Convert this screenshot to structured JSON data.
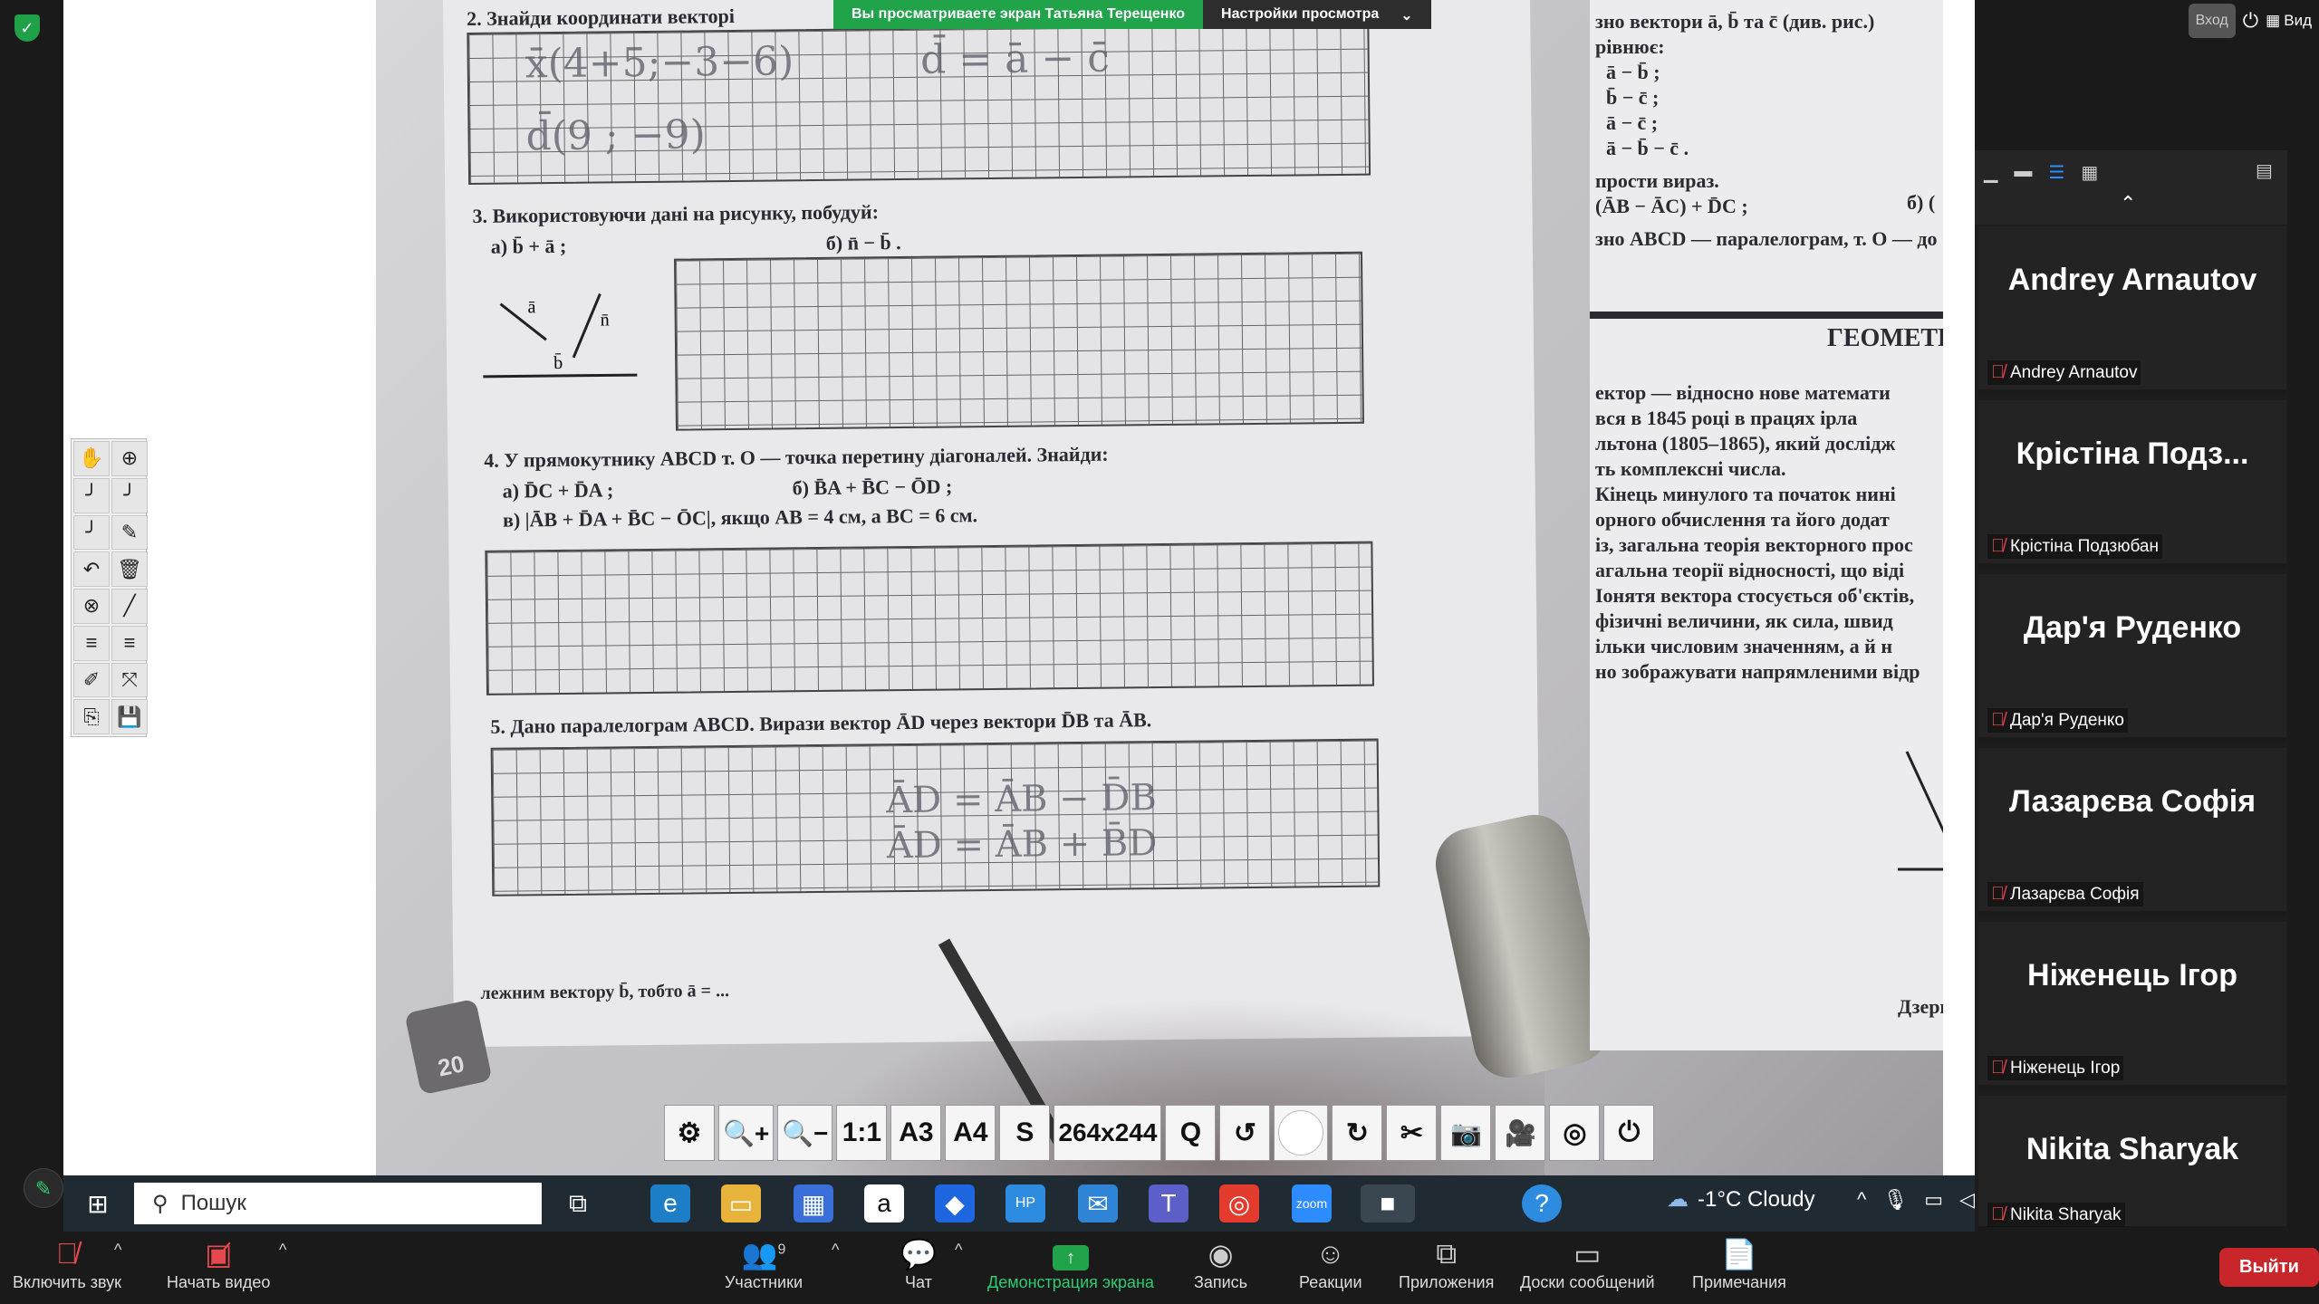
{
  "banner": {
    "viewing_text": "Вы просматриваете экран Татьяна Терещенко",
    "view_options": "Настройки просмотра"
  },
  "top_right": {
    "enter_label": "Вход",
    "view_label": "Вид"
  },
  "worksheet": {
    "line_top": "2. Знайди координати векторі",
    "task3": "3. Використовуючи дані на рисунку, побудуй:",
    "task3_a": "а) b̄ + ā ;",
    "task3_b": "б) n̄ − b̄ .",
    "task4": "4. У прямокутнику ABCD т. O — точка перетину діагоналей. Знайди:",
    "task4_a": "а) D̄C + D̄A ;",
    "task4_b": "б) B̄A + B̄C − ŌD ;",
    "task4_c": "в) |ĀB + D̄A + B̄C − ŌC|, якщо AB = 4 см, а BC = 6 см.",
    "task5": "5. Дано паралелограм ABCD. Вирази вектор ĀD через вектори D̄B та ĀB.",
    "bottom_line": "лежним вектору b̄, тобто ā = ...",
    "calc_label": "20",
    "right_lines": [
      "зно вектори ā, b̄ та c̄ (див. рис.)",
      "рівнює:",
      "ā − b̄ ;",
      "b̄ − c̄ ;",
      "ā − c̄ ;",
      "ā − b̄ − c̄ .",
      "прости вираз.",
      "(ĀB − ĀC) + D̄C ;",
      "зно ABCD — паралелограм, т. O — до"
    ],
    "right_b": "б) (",
    "right_heading": "ГЕОМЕТРИЧ",
    "right_para": [
      "ектор — відносно нове математи",
      "вся в 1845 році в працях ірла",
      "льтона (1805–1865), який дослідж",
      "ть комплексні числа.",
      "Кінець минулого та початок нині",
      "орного обчислення та його додат",
      "із, загальна теорія векторного прос",
      "агальна теорії відносності, що віді",
      "Іонятя вектора стосується об'єктів,",
      "фізичні величини, як сила, швид",
      "ільки числовим значенням, а й н",
      "но зображувати напрямленими відр"
    ],
    "right_caption": "Дзеркаль"
  },
  "camtools": [
    "⚙",
    "🔍+",
    "🔍−",
    "1:1",
    "A3",
    "A4",
    "S",
    "264x244",
    "Q",
    "↺",
    "",
    "↻",
    "✂",
    "📷",
    "🎥",
    "◎",
    "⏻"
  ],
  "taskbar": {
    "search_placeholder": "Пошук",
    "weather": "-1°C  Cloudy"
  },
  "controls": {
    "unmute": "Включить звук",
    "start_video": "Начать видео",
    "participants": "Участники",
    "participants_count": "9",
    "chat": "Чат",
    "share": "Демонстрация экрана",
    "record": "Запись",
    "reactions": "Реакции",
    "apps": "Приложения",
    "whiteboards": "Доски сообщений",
    "notes": "Примечания",
    "leave": "Выйти"
  },
  "participants": [
    {
      "display": "Andrey Arnautov",
      "name": "Andrey Arnautov"
    },
    {
      "display": "Крістіна Подз...",
      "name": "Крістіна Подзюбан"
    },
    {
      "display": "Дар'я Руденко",
      "name": "Дар'я Руденко"
    },
    {
      "display": "Лазарєва Софія",
      "name": "Лазарєва Софія"
    },
    {
      "display": "Ніженець Ігор",
      "name": "Ніженець Ігор"
    },
    {
      "display": "Nikita Sharyak",
      "name": "Nikita Sharyak"
    }
  ],
  "colors": {
    "share_green": "#21a34a",
    "leave_red": "#c9262b",
    "muted_red": "#e5484d"
  }
}
